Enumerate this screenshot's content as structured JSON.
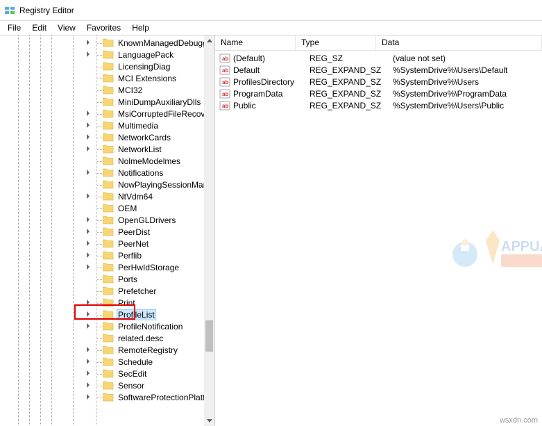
{
  "window": {
    "title": "Registry Editor"
  },
  "menu": {
    "file": "File",
    "edit": "Edit",
    "view": "View",
    "favorites": "Favorites",
    "help": "Help"
  },
  "tree": {
    "items": [
      {
        "label": "KnownManagedDebugg",
        "expandable": true
      },
      {
        "label": "LanguagePack",
        "expandable": true
      },
      {
        "label": "LicensingDiag",
        "expandable": false
      },
      {
        "label": "MCI Extensions",
        "expandable": false
      },
      {
        "label": "MCI32",
        "expandable": false
      },
      {
        "label": "MiniDumpAuxiliaryDlls",
        "expandable": false
      },
      {
        "label": "MsiCorruptedFileRecove",
        "expandable": true
      },
      {
        "label": "Multimedia",
        "expandable": true
      },
      {
        "label": "NetworkCards",
        "expandable": true
      },
      {
        "label": "NetworkList",
        "expandable": true
      },
      {
        "label": "NolmeModelmes",
        "expandable": false
      },
      {
        "label": "Notifications",
        "expandable": true
      },
      {
        "label": "NowPlayingSessionMan",
        "expandable": false
      },
      {
        "label": "NtVdm64",
        "expandable": true
      },
      {
        "label": "OEM",
        "expandable": false
      },
      {
        "label": "OpenGLDrivers",
        "expandable": true
      },
      {
        "label": "PeerDist",
        "expandable": true
      },
      {
        "label": "PeerNet",
        "expandable": true
      },
      {
        "label": "Perflib",
        "expandable": true
      },
      {
        "label": "PerHwIdStorage",
        "expandable": true
      },
      {
        "label": "Ports",
        "expandable": false
      },
      {
        "label": "Prefetcher",
        "expandable": false
      },
      {
        "label": "Print",
        "expandable": true
      },
      {
        "label": "ProfileList",
        "expandable": true,
        "selected": true
      },
      {
        "label": "ProfileNotification",
        "expandable": true
      },
      {
        "label": "related.desc",
        "expandable": false
      },
      {
        "label": "RemoteRegistry",
        "expandable": true
      },
      {
        "label": "Schedule",
        "expandable": true
      },
      {
        "label": "SecEdit",
        "expandable": true
      },
      {
        "label": "Sensor",
        "expandable": true
      },
      {
        "label": "SoftwareProtectionPlatf",
        "expandable": true
      }
    ]
  },
  "list": {
    "headers": {
      "name": "Name",
      "type": "Type",
      "data": "Data"
    },
    "rows": [
      {
        "name": "(Default)",
        "type": "REG_SZ",
        "data": "(value not set)"
      },
      {
        "name": "Default",
        "type": "REG_EXPAND_SZ",
        "data": "%SystemDrive%\\Users\\Default"
      },
      {
        "name": "ProfilesDirectory",
        "type": "REG_EXPAND_SZ",
        "data": "%SystemDrive%\\Users"
      },
      {
        "name": "ProgramData",
        "type": "REG_EXPAND_SZ",
        "data": "%SystemDrive%\\ProgramData"
      },
      {
        "name": "Public",
        "type": "REG_EXPAND_SZ",
        "data": "%SystemDrive%\\Users\\Public"
      }
    ]
  },
  "watermark": {
    "text": "APPUALS"
  },
  "attribution": "wsxdn.com"
}
